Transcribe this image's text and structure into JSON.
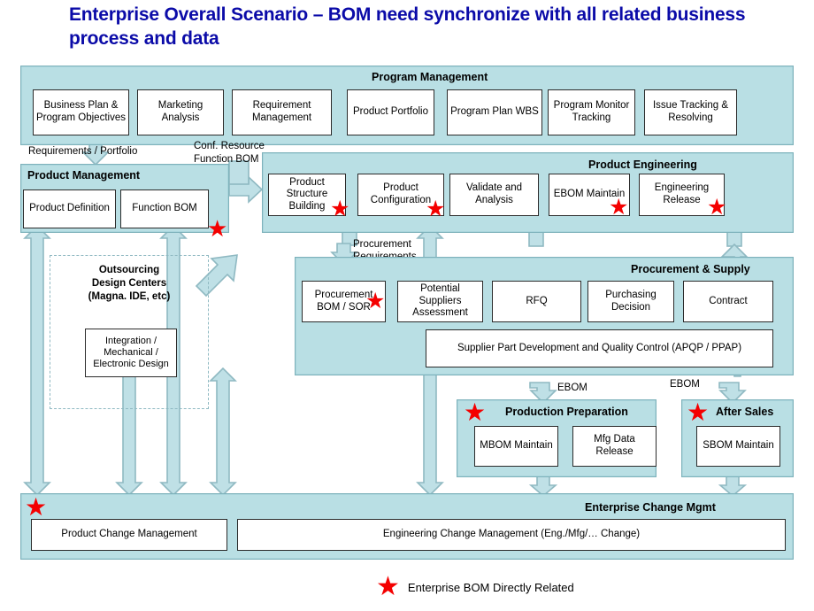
{
  "title": "Enterprise Overall Scenario – BOM need synchronize with all related business process and data",
  "colors": {
    "title": "#0b0ba8",
    "panel_fill": "#b9dfe4",
    "panel_border": "#7eb2bb",
    "box_fill": "#ffffff",
    "box_border": "#2b2b2b",
    "star": "#f40000",
    "arrow_fill": "#bfe0e6",
    "arrow_border": "#8fb9c2"
  },
  "sections": {
    "program_management": {
      "title": "Program Management",
      "boxes": [
        "Business Plan & Program Objectives",
        "Marketing Analysis",
        "Requirement Management",
        "Product Portfolio",
        "Program Plan WBS",
        "Program Monitor Tracking",
        "Issue Tracking & Resolving"
      ]
    },
    "product_management": {
      "title": "Product Management",
      "boxes": [
        "Product Definition",
        "Function BOM"
      ]
    },
    "product_engineering": {
      "title": "Product Engineering",
      "boxes": [
        "Product Structure Building",
        "Product Configuration",
        "Validate and Analysis",
        "EBOM Maintain",
        "Engineering Release"
      ]
    },
    "outsourcing": {
      "title": "Outsourcing\nDesign Centers\n(Magna. IDE, etc)",
      "boxes": [
        "Integration / Mechanical / Electronic Design"
      ]
    },
    "procurement_supply": {
      "title": "Procurement & Supply",
      "boxes": [
        "Procurement BOM / SOR",
        "Potential Suppliers Assessment",
        "RFQ",
        "Purchasing Decision",
        "Contract"
      ],
      "wide_box": "Supplier Part Development and Quality Control (APQP / PPAP)"
    },
    "production_preparation": {
      "title": "Production Preparation",
      "boxes": [
        "MBOM Maintain",
        "Mfg Data Release"
      ]
    },
    "after_sales": {
      "title": "After Sales",
      "boxes": [
        "SBOM Maintain"
      ]
    },
    "enterprise_change_mgmt": {
      "title": "Enterprise Change Mgmt",
      "boxes": [
        "Product Change Management",
        "Engineering Change Management (Eng./Mfg/… Change)"
      ]
    }
  },
  "flow_labels": {
    "requirements_portfolio": "Requirements / Portfolio",
    "conf_resource": "Conf. Resource",
    "function_bom": "Function BOM",
    "procurement": "Procurement",
    "requirements": "Requirements",
    "ebom_left": "EBOM",
    "ebom_right": "EBOM"
  },
  "legend": {
    "star_glyph": "★",
    "text": "Enterprise BOM Directly Related"
  },
  "star_glyph": "★"
}
